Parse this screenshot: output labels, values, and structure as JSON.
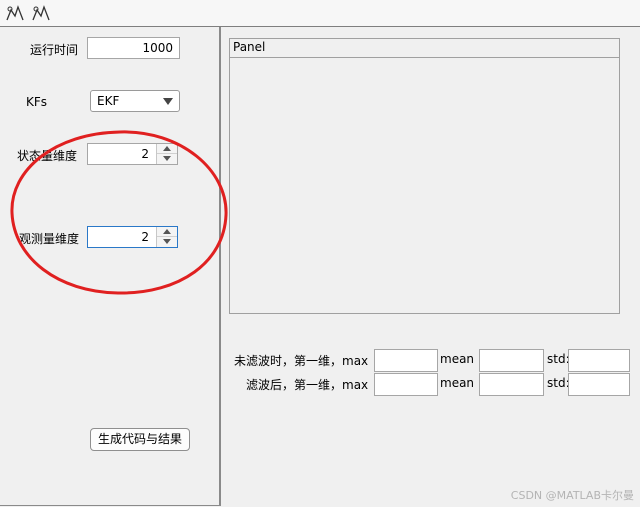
{
  "toolbar": {
    "icons": [
      "plot-tool-icon",
      "plot-tool-icon"
    ]
  },
  "controls": {
    "runtime": {
      "label": "运行时间",
      "value": "1000"
    },
    "kfs": {
      "label": "KFs",
      "selected": "EKF"
    },
    "state_dim": {
      "label": "状态量维度",
      "value": "2"
    },
    "obs_dim": {
      "label": "观测量维度",
      "value": "2"
    },
    "generate_button": "生成代码与结果"
  },
  "panel": {
    "title": "Panel"
  },
  "results": {
    "row1": {
      "label": "未滤波时，第一维，max",
      "mean": "mean",
      "std": "std:"
    },
    "row2": {
      "label": "滤波后，第一维，max",
      "mean": "mean",
      "std": "std:"
    }
  },
  "annotation": {
    "color": "#e02020"
  },
  "watermark": "CSDN @MATLAB卡尔曼"
}
